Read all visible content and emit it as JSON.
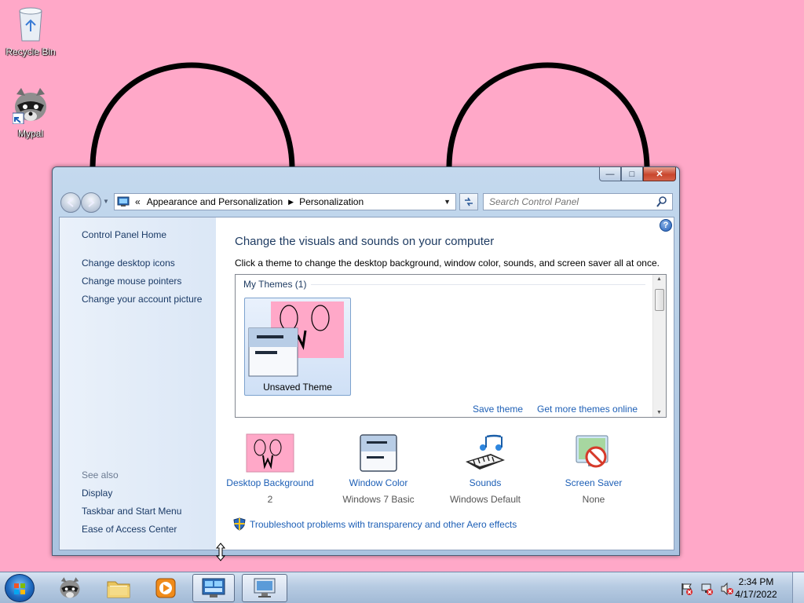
{
  "desktop": {
    "icons": [
      {
        "label": "Recycle Bin",
        "icon": "recycle-bin-icon"
      },
      {
        "label": "Mypal",
        "icon": "raccoon-icon"
      }
    ]
  },
  "window": {
    "address": {
      "overflow": "«",
      "crumbs": [
        "Appearance and Personalization",
        "Personalization"
      ]
    },
    "search": {
      "placeholder": "Search Control Panel"
    },
    "sidebar": {
      "home": "Control Panel Home",
      "links": [
        "Change desktop icons",
        "Change mouse pointers",
        "Change your account picture"
      ],
      "see_also_heading": "See also",
      "see_also": [
        "Display",
        "Taskbar and Start Menu",
        "Ease of Access Center"
      ]
    },
    "main": {
      "heading": "Change the visuals and sounds on your computer",
      "description": "Click a theme to change the desktop background, window color, sounds, and screen saver all at once.",
      "themes_group": "My Themes (1)",
      "theme_name": "Unsaved Theme",
      "save_theme": "Save theme",
      "get_more": "Get more themes online",
      "options": [
        {
          "label": "Desktop Background",
          "value": "2",
          "icon": "desktop-background-icon"
        },
        {
          "label": "Window Color",
          "value": "Windows 7 Basic",
          "icon": "window-color-icon"
        },
        {
          "label": "Sounds",
          "value": "Windows Default",
          "icon": "sounds-icon"
        },
        {
          "label": "Screen Saver",
          "value": "None",
          "icon": "screen-saver-icon"
        }
      ],
      "troubleshoot": "Troubleshoot problems with transparency and other Aero effects"
    }
  },
  "taskbar": {
    "time": "2:34 PM",
    "date": "4/17/2022"
  },
  "colors": {
    "wallpaper": "#ffa8c8",
    "link": "#1d5fb6",
    "heading": "#1e3b62"
  }
}
